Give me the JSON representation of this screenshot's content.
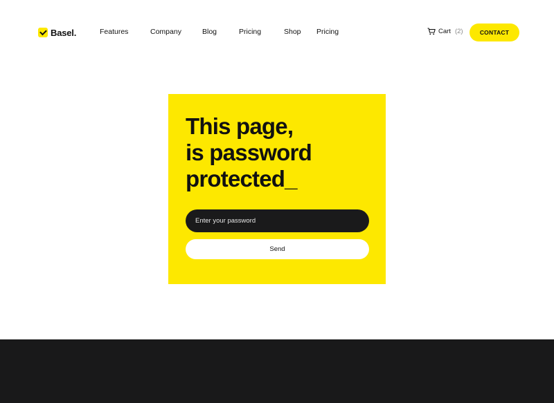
{
  "header": {
    "logo_text": "Basel.",
    "nav": [
      {
        "label": "Features"
      },
      {
        "label": "Company"
      },
      {
        "label": "Blog"
      },
      {
        "label": "Pricing"
      },
      {
        "label": "Shop"
      },
      {
        "label": "Pricing"
      }
    ],
    "cart_label": "Cart",
    "cart_count": "(2)",
    "contact_label": "CONTACT"
  },
  "main": {
    "heading_lines": [
      "This page,",
      "is password",
      "protected_"
    ],
    "password_placeholder": "Enter your password",
    "send_label": "Send"
  },
  "colors": {
    "accent": "#fde800",
    "dark": "#1a1a1b",
    "footer": "#19191a"
  },
  "icons": {
    "logo": "check-badge-icon",
    "cart": "shopping-cart-icon"
  }
}
